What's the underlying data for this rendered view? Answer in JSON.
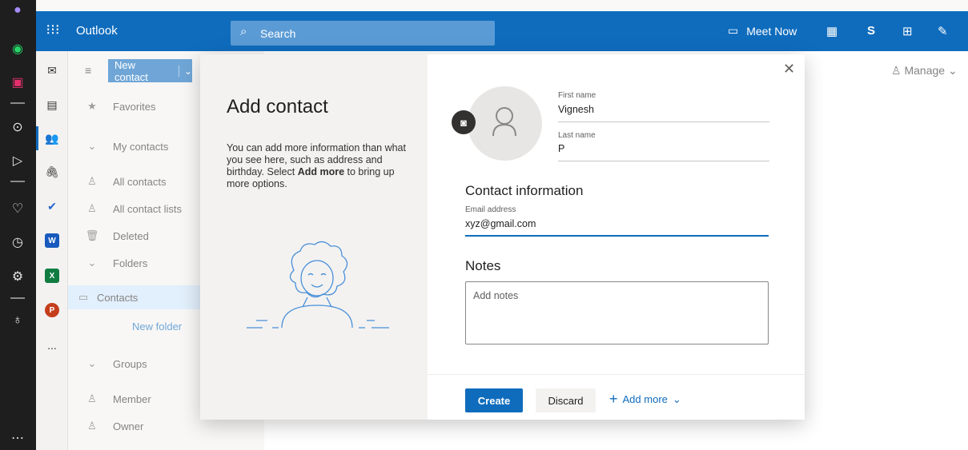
{
  "app": {
    "name": "Outlook"
  },
  "search": {
    "placeholder": "Search"
  },
  "topbar": {
    "meet_now": "Meet Now"
  },
  "toolbar": {
    "new_contact": "New contact",
    "manage": "Manage"
  },
  "folders": {
    "favorites": "Favorites",
    "my_contacts": "My contacts",
    "all_contacts": "All contacts",
    "all_contact_lists": "All contact lists",
    "deleted": "Deleted",
    "folders": "Folders",
    "contacts": "Contacts",
    "new_folder": "New folder",
    "groups": "Groups",
    "member": "Member",
    "owner": "Owner"
  },
  "rail": {
    "more": "..."
  },
  "dialog": {
    "title": "Add contact",
    "description_pre": "You can add more information than what you see here, such as address and birthday. Select ",
    "description_bold": "Add more",
    "description_post": " to bring up more options.",
    "first_name_label": "First name",
    "first_name_value": "Vignesh",
    "last_name_label": "Last name",
    "last_name_value": "P",
    "contact_info_heading": "Contact information",
    "email_label": "Email address",
    "email_value": "xyz@gmail.com",
    "notes_heading": "Notes",
    "notes_placeholder": "Add notes",
    "create": "Create",
    "discard": "Discard",
    "add_more": "Add more"
  },
  "colors": {
    "brand": "#0f6cbd",
    "sysbar": "#1e1e1e"
  }
}
